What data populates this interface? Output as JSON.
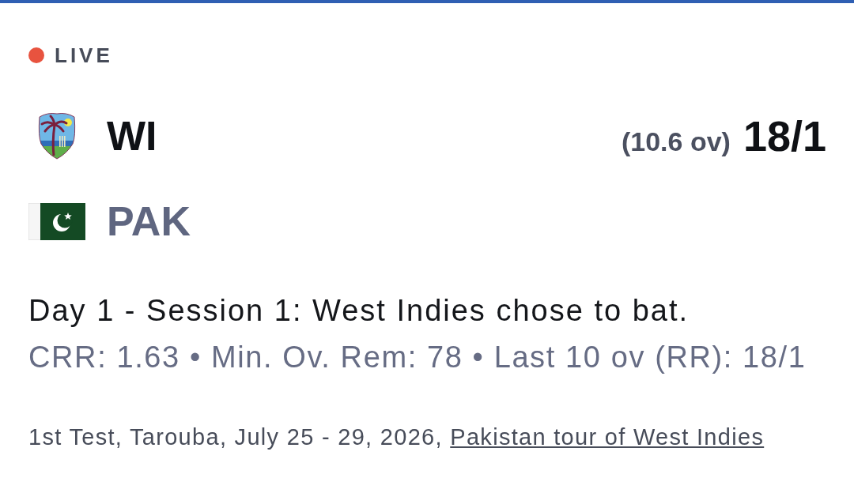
{
  "status": {
    "label": "LIVE",
    "live": true
  },
  "teams": [
    {
      "name": "WI",
      "kind": "crest",
      "batting": true,
      "overs": "(10.6 ov)",
      "score": "18/1"
    },
    {
      "name": "PAK",
      "kind": "flag",
      "batting": false
    }
  ],
  "summary": "Day 1 - Session 1: West Indies chose to bat.",
  "stats": "CRR: 1.63 • Min. Ov. Rem: 78 • Last 10 ov (RR): 18/1",
  "footer": {
    "text": "1st Test, Tarouba, July 25 - 29, 2026,",
    "link": "Pakistan tour of West Indies"
  }
}
